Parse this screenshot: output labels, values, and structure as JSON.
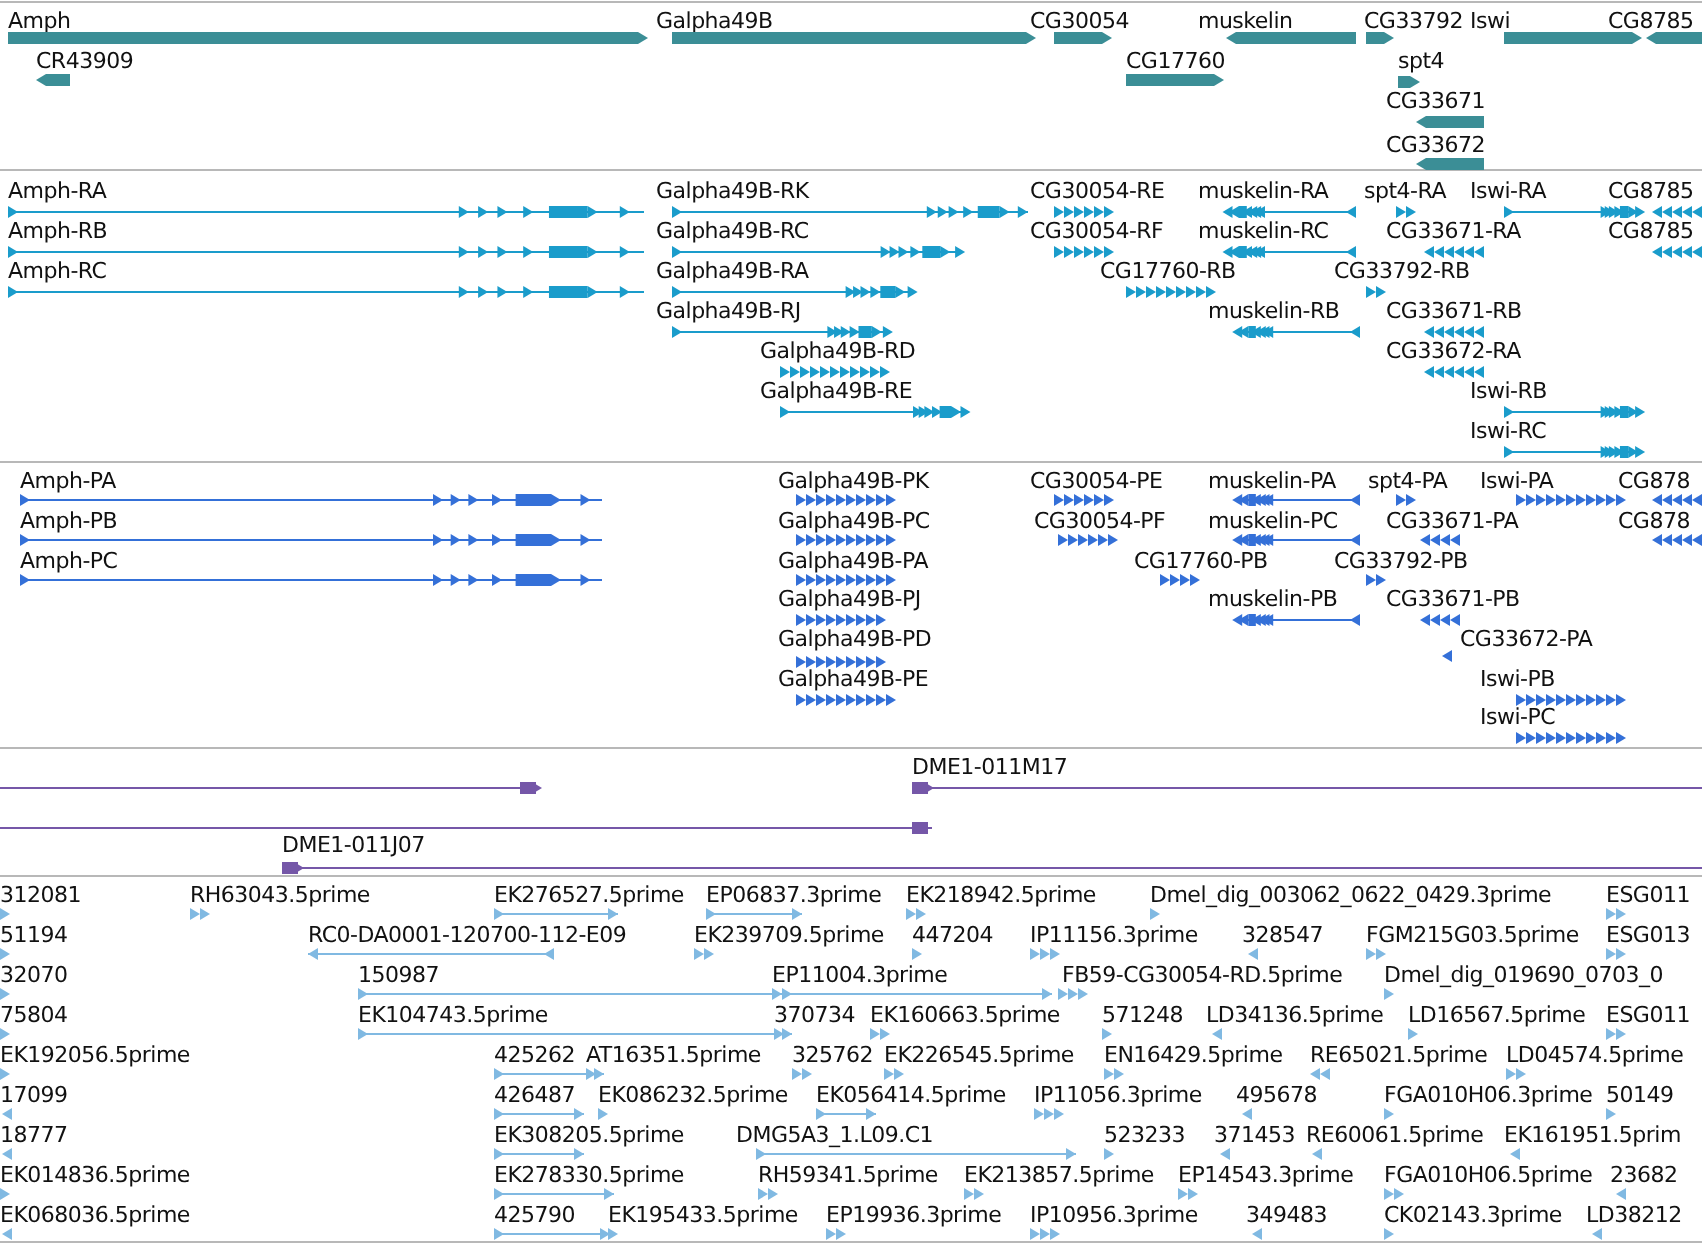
{
  "tracks": [
    {
      "kind": "gene",
      "features": [
        {
          "label": "Amph",
          "reverse": false
        },
        {
          "label": "Galpha49B",
          "reverse": false
        },
        {
          "label": "CG30054",
          "reverse": false
        },
        {
          "label": "muskelin",
          "reverse": true
        },
        {
          "label": "CG33792",
          "reverse": false
        },
        {
          "label": "Iswi",
          "reverse": false
        },
        {
          "label": "CG8785",
          "reverse": true
        },
        {
          "label": "CR43909",
          "reverse": true
        },
        {
          "label": "CG17760",
          "reverse": false
        },
        {
          "label": "spt4",
          "reverse": false
        },
        {
          "label": "CG33671",
          "reverse": true
        },
        {
          "label": "CG33672",
          "reverse": true
        }
      ]
    },
    {
      "kind": "transcript",
      "features": [
        {
          "label": "Amph-RA",
          "reverse": false
        },
        {
          "label": "Galpha49B-RK",
          "reverse": false
        },
        {
          "label": "CG30054-RE",
          "reverse": false
        },
        {
          "label": "muskelin-RA",
          "reverse": true
        },
        {
          "label": "spt4-RA",
          "reverse": false
        },
        {
          "label": "Iswi-RA",
          "reverse": false
        },
        {
          "label": "CG8785",
          "reverse": true
        },
        {
          "label": "Amph-RB",
          "reverse": false
        },
        {
          "label": "Galpha49B-RC",
          "reverse": false
        },
        {
          "label": "CG30054-RF",
          "reverse": false
        },
        {
          "label": "muskelin-RC",
          "reverse": true
        },
        {
          "label": "CG33671-RA",
          "reverse": true
        },
        {
          "label": "CG8785",
          "reverse": true
        },
        {
          "label": "Amph-RC",
          "reverse": false
        },
        {
          "label": "Galpha49B-RA",
          "reverse": false
        },
        {
          "label": "CG17760-RB",
          "reverse": false
        },
        {
          "label": "CG33792-RB",
          "reverse": false
        },
        {
          "label": "Galpha49B-RJ",
          "reverse": false
        },
        {
          "label": "muskelin-RB",
          "reverse": true
        },
        {
          "label": "CG33671-RB",
          "reverse": true
        },
        {
          "label": "Galpha49B-RD",
          "reverse": false
        },
        {
          "label": "CG33672-RA",
          "reverse": true
        },
        {
          "label": "Galpha49B-RE",
          "reverse": false
        },
        {
          "label": "Iswi-RB",
          "reverse": false
        },
        {
          "label": "Iswi-RC",
          "reverse": false
        }
      ]
    },
    {
      "kind": "protein",
      "features": [
        {
          "label": "Amph-PA",
          "reverse": false
        },
        {
          "label": "Galpha49B-PK",
          "reverse": false
        },
        {
          "label": "CG30054-PE",
          "reverse": false
        },
        {
          "label": "muskelin-PA",
          "reverse": true
        },
        {
          "label": "spt4-PA",
          "reverse": false
        },
        {
          "label": "Iswi-PA",
          "reverse": false
        },
        {
          "label": "CG878",
          "reverse": true
        },
        {
          "label": "Amph-PB",
          "reverse": false
        },
        {
          "label": "Galpha49B-PC",
          "reverse": false
        },
        {
          "label": "CG30054-PF",
          "reverse": false
        },
        {
          "label": "muskelin-PC",
          "reverse": true
        },
        {
          "label": "CG33671-PA",
          "reverse": true
        },
        {
          "label": "CG878",
          "reverse": true
        },
        {
          "label": "Amph-PC",
          "reverse": false
        },
        {
          "label": "Galpha49B-PA",
          "reverse": false
        },
        {
          "label": "CG17760-PB",
          "reverse": false
        },
        {
          "label": "CG33792-PB",
          "reverse": false
        },
        {
          "label": "Galpha49B-PJ",
          "reverse": false
        },
        {
          "label": "muskelin-PB",
          "reverse": true
        },
        {
          "label": "CG33671-PB",
          "reverse": true
        },
        {
          "label": "Galpha49B-PD",
          "reverse": false
        },
        {
          "label": "CG33672-PA",
          "reverse": true
        },
        {
          "label": "Galpha49B-PE",
          "reverse": false
        },
        {
          "label": "Iswi-PB",
          "reverse": false
        },
        {
          "label": "Iswi-PC",
          "reverse": false
        }
      ]
    },
    {
      "kind": "clone",
      "features": [
        {
          "reverse": false
        },
        {
          "label": "DME1-011M17",
          "reverse": false
        },
        {
          "reverse": true
        },
        {
          "label": "DME1-011J07",
          "reverse": false
        }
      ]
    },
    {
      "kind": "est",
      "features": [
        {
          "label": "312081",
          "reverse": false
        },
        {
          "label": "RH63043.5prime",
          "reverse": false
        },
        {
          "label": "EK276527.5prime",
          "reverse": false
        },
        {
          "label": "EP06837.3prime",
          "reverse": false
        },
        {
          "label": "EK218942.5prime",
          "reverse": false
        },
        {
          "label": "Dmel_dig_003062_0622_0429.3prime",
          "reverse": false
        },
        {
          "label": "ESG011",
          "reverse": false
        },
        {
          "label": "51194",
          "reverse": false
        },
        {
          "label": "RC0-DA0001-120700-112-E09",
          "reverse": true
        },
        {
          "label": "EK239709.5prime",
          "reverse": false
        },
        {
          "label": "447204",
          "reverse": false
        },
        {
          "label": "IP11156.3prime",
          "reverse": false
        },
        {
          "label": "328547",
          "reverse": true
        },
        {
          "label": "FGM215G03.5prime",
          "reverse": false
        },
        {
          "label": "ESG013",
          "reverse": false
        },
        {
          "label": "32070",
          "reverse": false
        },
        {
          "label": "150987",
          "reverse": false
        },
        {
          "label": "EP11004.3prime",
          "reverse": false
        },
        {
          "label": "FB59-CG30054-RD.5prime",
          "reverse": false
        },
        {
          "label": "Dmel_dig_019690_0703_0",
          "reverse": false
        },
        {
          "label": "75804",
          "reverse": false
        },
        {
          "label": "EK104743.5prime",
          "reverse": false
        },
        {
          "label": "370734",
          "reverse": false
        },
        {
          "label": "EK160663.5prime",
          "reverse": false
        },
        {
          "label": "571248",
          "reverse": false
        },
        {
          "label": "LD34136.5prime",
          "reverse": true
        },
        {
          "label": "LD16567.5prime",
          "reverse": false
        },
        {
          "label": "ESG011",
          "reverse": false
        },
        {
          "label": "EK192056.5prime",
          "reverse": false
        },
        {
          "label": "425262",
          "reverse": false
        },
        {
          "label": "AT16351.5prime",
          "reverse": false
        },
        {
          "label": "325762",
          "reverse": false
        },
        {
          "label": "EK226545.5prime",
          "reverse": false
        },
        {
          "label": "EN16429.5prime",
          "reverse": false
        },
        {
          "label": "RE65021.5prime",
          "reverse": true
        },
        {
          "label": "LD04574.5prime",
          "reverse": false
        },
        {
          "label": "17099",
          "reverse": true
        },
        {
          "label": "426487",
          "reverse": false
        },
        {
          "label": "EK086232.5prime",
          "reverse": false
        },
        {
          "label": "EK056414.5prime",
          "reverse": false
        },
        {
          "label": "IP11056.3prime",
          "reverse": false
        },
        {
          "label": "495678",
          "reverse": true
        },
        {
          "label": "FGA010H06.3prime",
          "reverse": false
        },
        {
          "label": "50149",
          "reverse": false
        },
        {
          "label": "18777",
          "reverse": true
        },
        {
          "label": "EK308205.5prime",
          "reverse": false
        },
        {
          "label": "DMG5A3_1.L09.C1",
          "reverse": false
        },
        {
          "label": "523233",
          "reverse": false
        },
        {
          "label": "371453",
          "reverse": true
        },
        {
          "label": "RE60061.5prime",
          "reverse": true
        },
        {
          "label": "EK161951.5prim",
          "reverse": true
        },
        {
          "label": "EK014836.5prime",
          "reverse": false
        },
        {
          "label": "EK278330.5prime",
          "reverse": false
        },
        {
          "label": "RH59341.5prime",
          "reverse": false
        },
        {
          "label": "EK213857.5prime",
          "reverse": false
        },
        {
          "label": "EP14543.3prime",
          "reverse": false
        },
        {
          "label": "FGA010H06.5prime",
          "reverse": false
        },
        {
          "label": "23682",
          "reverse": true
        },
        {
          "label": "EK068036.5prime",
          "reverse": true
        },
        {
          "label": "425790",
          "reverse": false
        },
        {
          "label": "EK195433.5prime",
          "reverse": false
        },
        {
          "label": "EP19936.3prime",
          "reverse": false
        },
        {
          "label": "IP10956.3prime",
          "reverse": false
        },
        {
          "label": "349483",
          "reverse": true
        },
        {
          "label": "CK02143.3prime",
          "reverse": false
        },
        {
          "label": "LD38212",
          "reverse": true
        }
      ]
    }
  ]
}
